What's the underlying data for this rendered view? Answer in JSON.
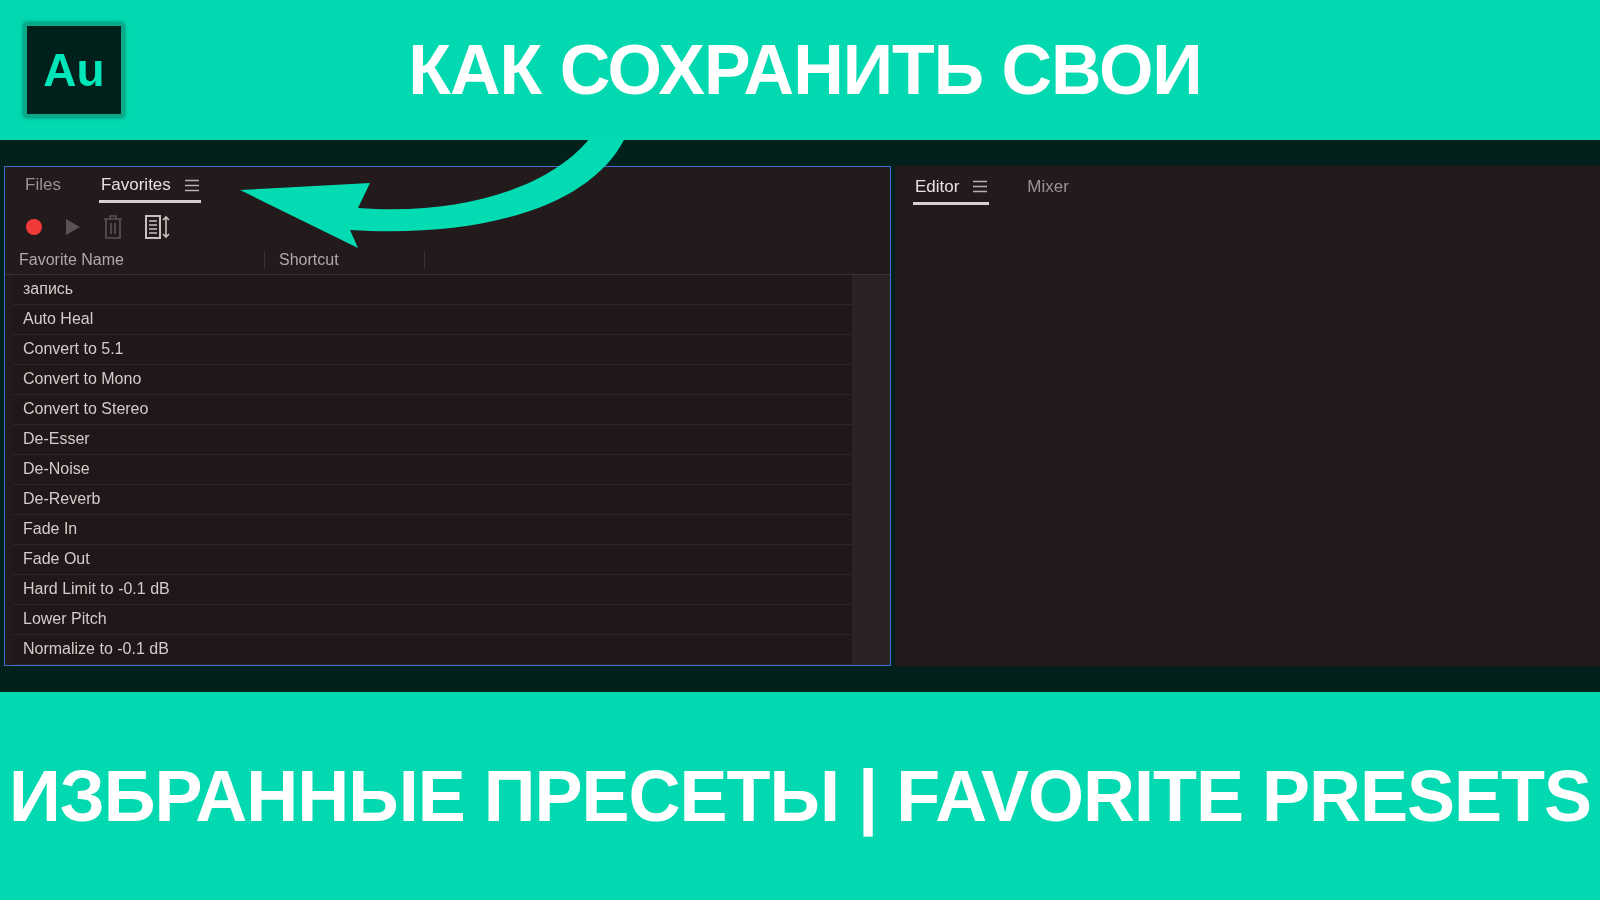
{
  "logo": {
    "text": "Au"
  },
  "title": "КАК СОХРАНИТЬ СВОИ",
  "left_panel": {
    "tabs": [
      {
        "label": "Files",
        "selected": false,
        "menu": false
      },
      {
        "label": "Favorites",
        "selected": true,
        "menu": true
      }
    ],
    "toolbar": [
      {
        "kind": "record",
        "disabled": false
      },
      {
        "kind": "play",
        "disabled": true
      },
      {
        "kind": "delete",
        "disabled": true
      },
      {
        "kind": "sort",
        "disabled": false
      }
    ],
    "columns": [
      "Favorite Name",
      "Shortcut"
    ],
    "rows": [
      "запись",
      "Auto Heal",
      "Convert to 5.1",
      "Convert to Mono",
      "Convert to Stereo",
      "De-Esser",
      "De-Noise",
      "De-Reverb",
      "Fade In",
      "Fade Out",
      "Hard Limit to -0.1 dB",
      "Lower Pitch",
      "Normalize to -0.1 dB"
    ]
  },
  "right_panel": {
    "tabs": [
      {
        "label": "Editor",
        "selected": true,
        "menu": true
      },
      {
        "label": "Mixer",
        "selected": false,
        "menu": false
      }
    ]
  },
  "caption": "ИЗБРАННЫЕ ПРЕСЕТЫ | FAVORITE PRESETS"
}
